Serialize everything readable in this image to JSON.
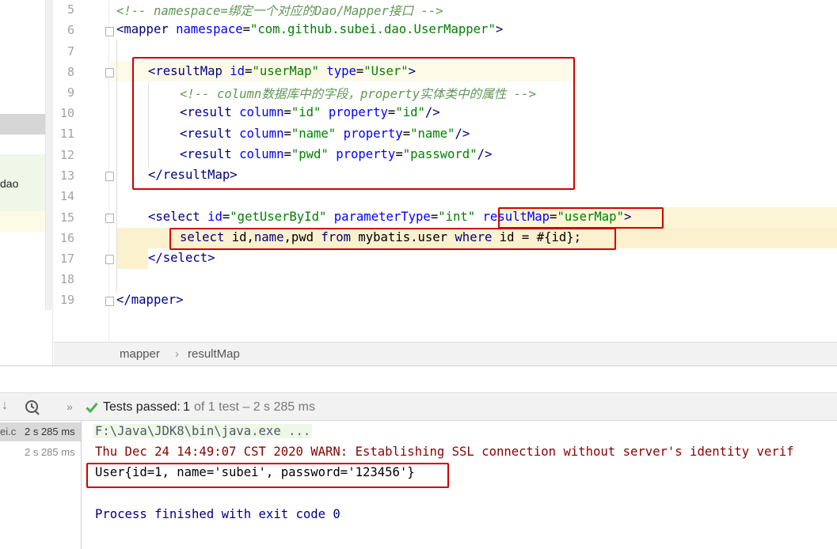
{
  "sidebar": {
    "partial_item": "dao"
  },
  "editor": {
    "line_numbers": [
      "5",
      "6",
      "7",
      "8",
      "9",
      "10",
      "11",
      "12",
      "13",
      "14",
      "15",
      "16",
      "17",
      "18",
      "19"
    ],
    "lines": {
      "l5": {
        "comment": "<!-- namespace=绑定一个对应的Dao/Mapper接口 -->"
      },
      "l6": {
        "open": "<",
        "tag": "mapper",
        "sp": " ",
        "attr": "namespace",
        "eq": "=",
        "val": "\"com.github.subei.dao.UserMapper\"",
        "close": ">"
      },
      "l8": {
        "open": "<",
        "tag": "resultMap",
        "a1": "id",
        "v1": "\"userMap\"",
        "a2": "type",
        "v2": "\"User\"",
        "close": ">"
      },
      "l9": {
        "comment": "<!-- column数据库中的字段，property实体类中的属性 -->"
      },
      "l10": {
        "tag": "result",
        "a1": "column",
        "v1": "\"id\"",
        "a2": "property",
        "v2": "\"id\"",
        "close": "/>"
      },
      "l11": {
        "tag": "result",
        "a1": "column",
        "v1": "\"name\"",
        "a2": "property",
        "v2": "\"name\"",
        "close": "/>"
      },
      "l12": {
        "tag": "result",
        "a1": "column",
        "v1": "\"pwd\"",
        "a2": "property",
        "v2": "\"password\"",
        "close": "/>"
      },
      "l13": {
        "open": "</",
        "tag": "resultMap",
        "close": ">"
      },
      "l15": {
        "tag": "select",
        "a1": "id",
        "v1": "\"getUserById\"",
        "a2": "parameterType",
        "v2": "\"int\"",
        "a3": "resultMap",
        "v3": "\"userMap\"",
        "close": ">"
      },
      "l16": {
        "k1": "select",
        "t1": " id,",
        "k2": "name",
        "t2": ",pwd ",
        "k3": "from",
        "t3": " mybatis.user ",
        "k4": "where",
        "t4": " id = #{id};"
      },
      "l17": {
        "open": "</",
        "tag": "select",
        "close": ">"
      },
      "l19": {
        "open": "</",
        "tag": "mapper",
        "close": ">"
      }
    }
  },
  "breadcrumb": {
    "items": [
      "mapper",
      "resultMap"
    ],
    "separator": "›"
  },
  "run": {
    "status_prefix": "Tests passed:",
    "status_count": "1",
    "status_rest": "of 1 test – 2 s 285 ms",
    "tree": [
      {
        "label": "ei.c",
        "time": "2 s 285 ms"
      },
      {
        "label": "",
        "time": "2 s 285 ms"
      }
    ],
    "console": {
      "cmd": "F:\\Java\\JDK8\\bin\\java.exe ...",
      "warn": "Thu Dec 24 14:49:07 CST 2020 WARN: Establishing SSL connection without server's identity verif",
      "result": "User{id=1, name='subei', password='123456'}",
      "exit": "Process finished with exit code 0"
    }
  },
  "colors": {
    "tag": "#000080",
    "attribute": "#0000ff",
    "string": "#008000",
    "comment": "#629755",
    "highlight_box": "#d20000",
    "current_line": "#fdfbe3",
    "test_pass": "#4caf50"
  }
}
